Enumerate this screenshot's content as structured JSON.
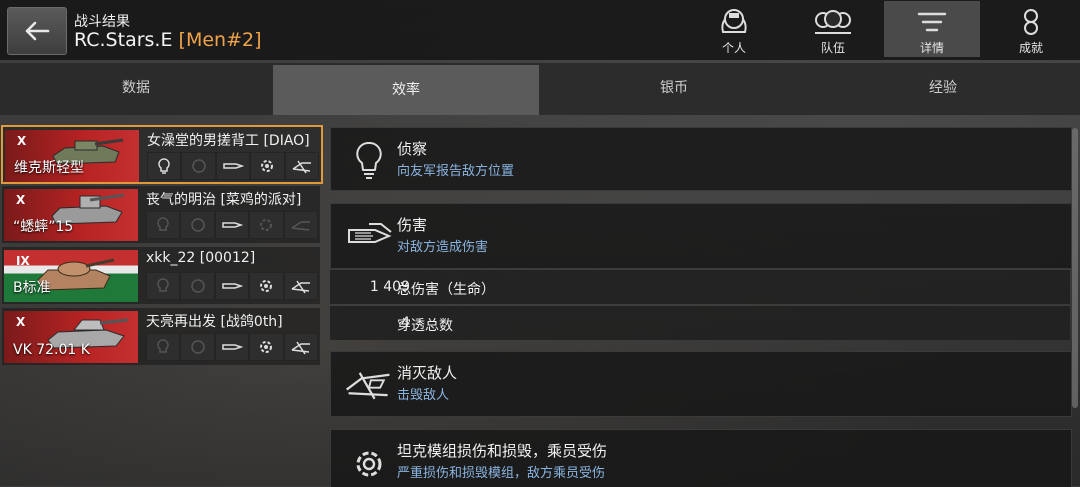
{
  "header": {
    "subtitle": "战斗结果",
    "player_name": "RC.Stars.E",
    "clan_tag": "[Men#2]"
  },
  "nav": [
    {
      "label": "个人",
      "icon": "personal-icon"
    },
    {
      "label": "队伍",
      "icon": "team-icon"
    },
    {
      "label": "详情",
      "icon": "details-icon",
      "active": true
    },
    {
      "label": "成就",
      "icon": "achievements-icon"
    }
  ],
  "tabs": [
    {
      "label": "数据"
    },
    {
      "label": "效率",
      "active": true
    },
    {
      "label": "银币"
    },
    {
      "label": "经验"
    }
  ],
  "players": [
    {
      "name": "女澡堂的男搓背工 [DIAO]",
      "tank": "维克斯轻型",
      "tier": "X",
      "flag": "red",
      "selected": true
    },
    {
      "name": "丧气的明治 [菜鸡的派对]",
      "tank": "“蟋蟀”15",
      "tier": "X",
      "flag": "red"
    },
    {
      "name": "xkk_22 [00012]",
      "tank": "B标准",
      "tier": "IX",
      "flag": "green"
    },
    {
      "name": "天亮再出发 [战鸽0th]",
      "tank": "VK 72.01 K",
      "tier": "X",
      "flag": "red"
    }
  ],
  "award_icons": [
    "spotting-icon",
    "assist-icon",
    "damage-icon",
    "module-icon",
    "kill-icon"
  ],
  "stats": {
    "spotting": {
      "title": "侦察",
      "desc": "向友军报告敌方位置"
    },
    "damage": {
      "title": "伤害",
      "desc": "对敌方造成伤害"
    },
    "rows": [
      {
        "value": "1 409",
        "label": "总伤害（生命）"
      },
      {
        "value": "4",
        "label": "穿透总数"
      }
    ],
    "kills": {
      "title": "消灭敌人",
      "desc": "击毁敌人"
    },
    "modules": {
      "title": "坦克模组损伤和损毁，乘员受伤",
      "desc": "严重损伤和损毁模组，敌方乘员受伤"
    }
  },
  "colors": {
    "accent": "#e09a3c",
    "desc_blue": "#8ab4e0"
  }
}
